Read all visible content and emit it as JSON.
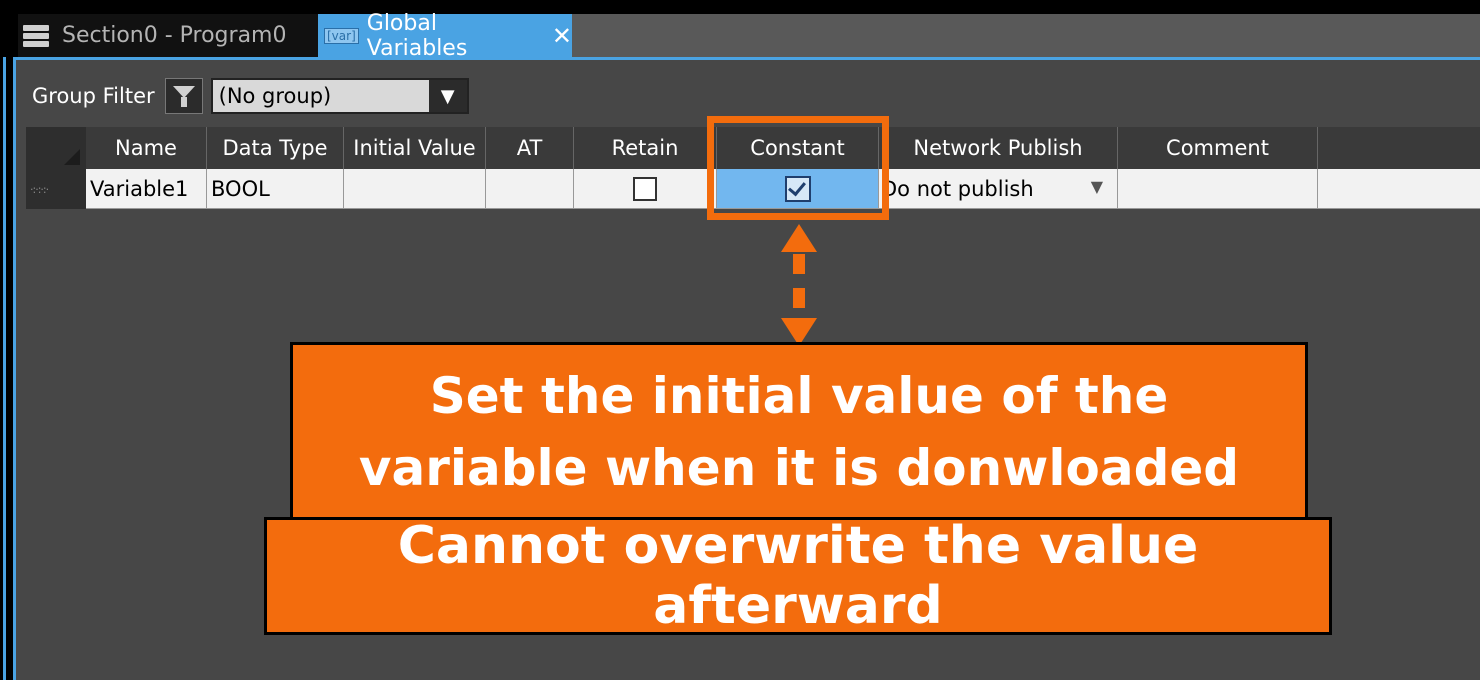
{
  "tabs": [
    {
      "label": "Section0 - Program0",
      "active": false,
      "icon": "program-icon"
    },
    {
      "label": "Global Variables",
      "active": true,
      "icon": "var-icon",
      "icon_text": "[var]"
    }
  ],
  "filter": {
    "label": "Group Filter",
    "selected": "(No group)"
  },
  "grid": {
    "columns": [
      "Name",
      "Data Type",
      "Initial Value",
      "AT",
      "Retain",
      "Constant",
      "Network Publish",
      "Comment"
    ],
    "rows": [
      {
        "name": "Variable1",
        "data_type": "BOOL",
        "initial_value": "",
        "at": "",
        "retain": false,
        "constant": true,
        "network_publish": "Do not publish",
        "comment": ""
      }
    ]
  },
  "annotations": {
    "callout_primary": "Set the initial value of the variable when it is donwloaded",
    "callout_secondary": "Cannot overwrite the value afterward"
  },
  "colors": {
    "accent": "#4aa3e3",
    "highlight": "#f36c0d",
    "panel": "#474747"
  }
}
